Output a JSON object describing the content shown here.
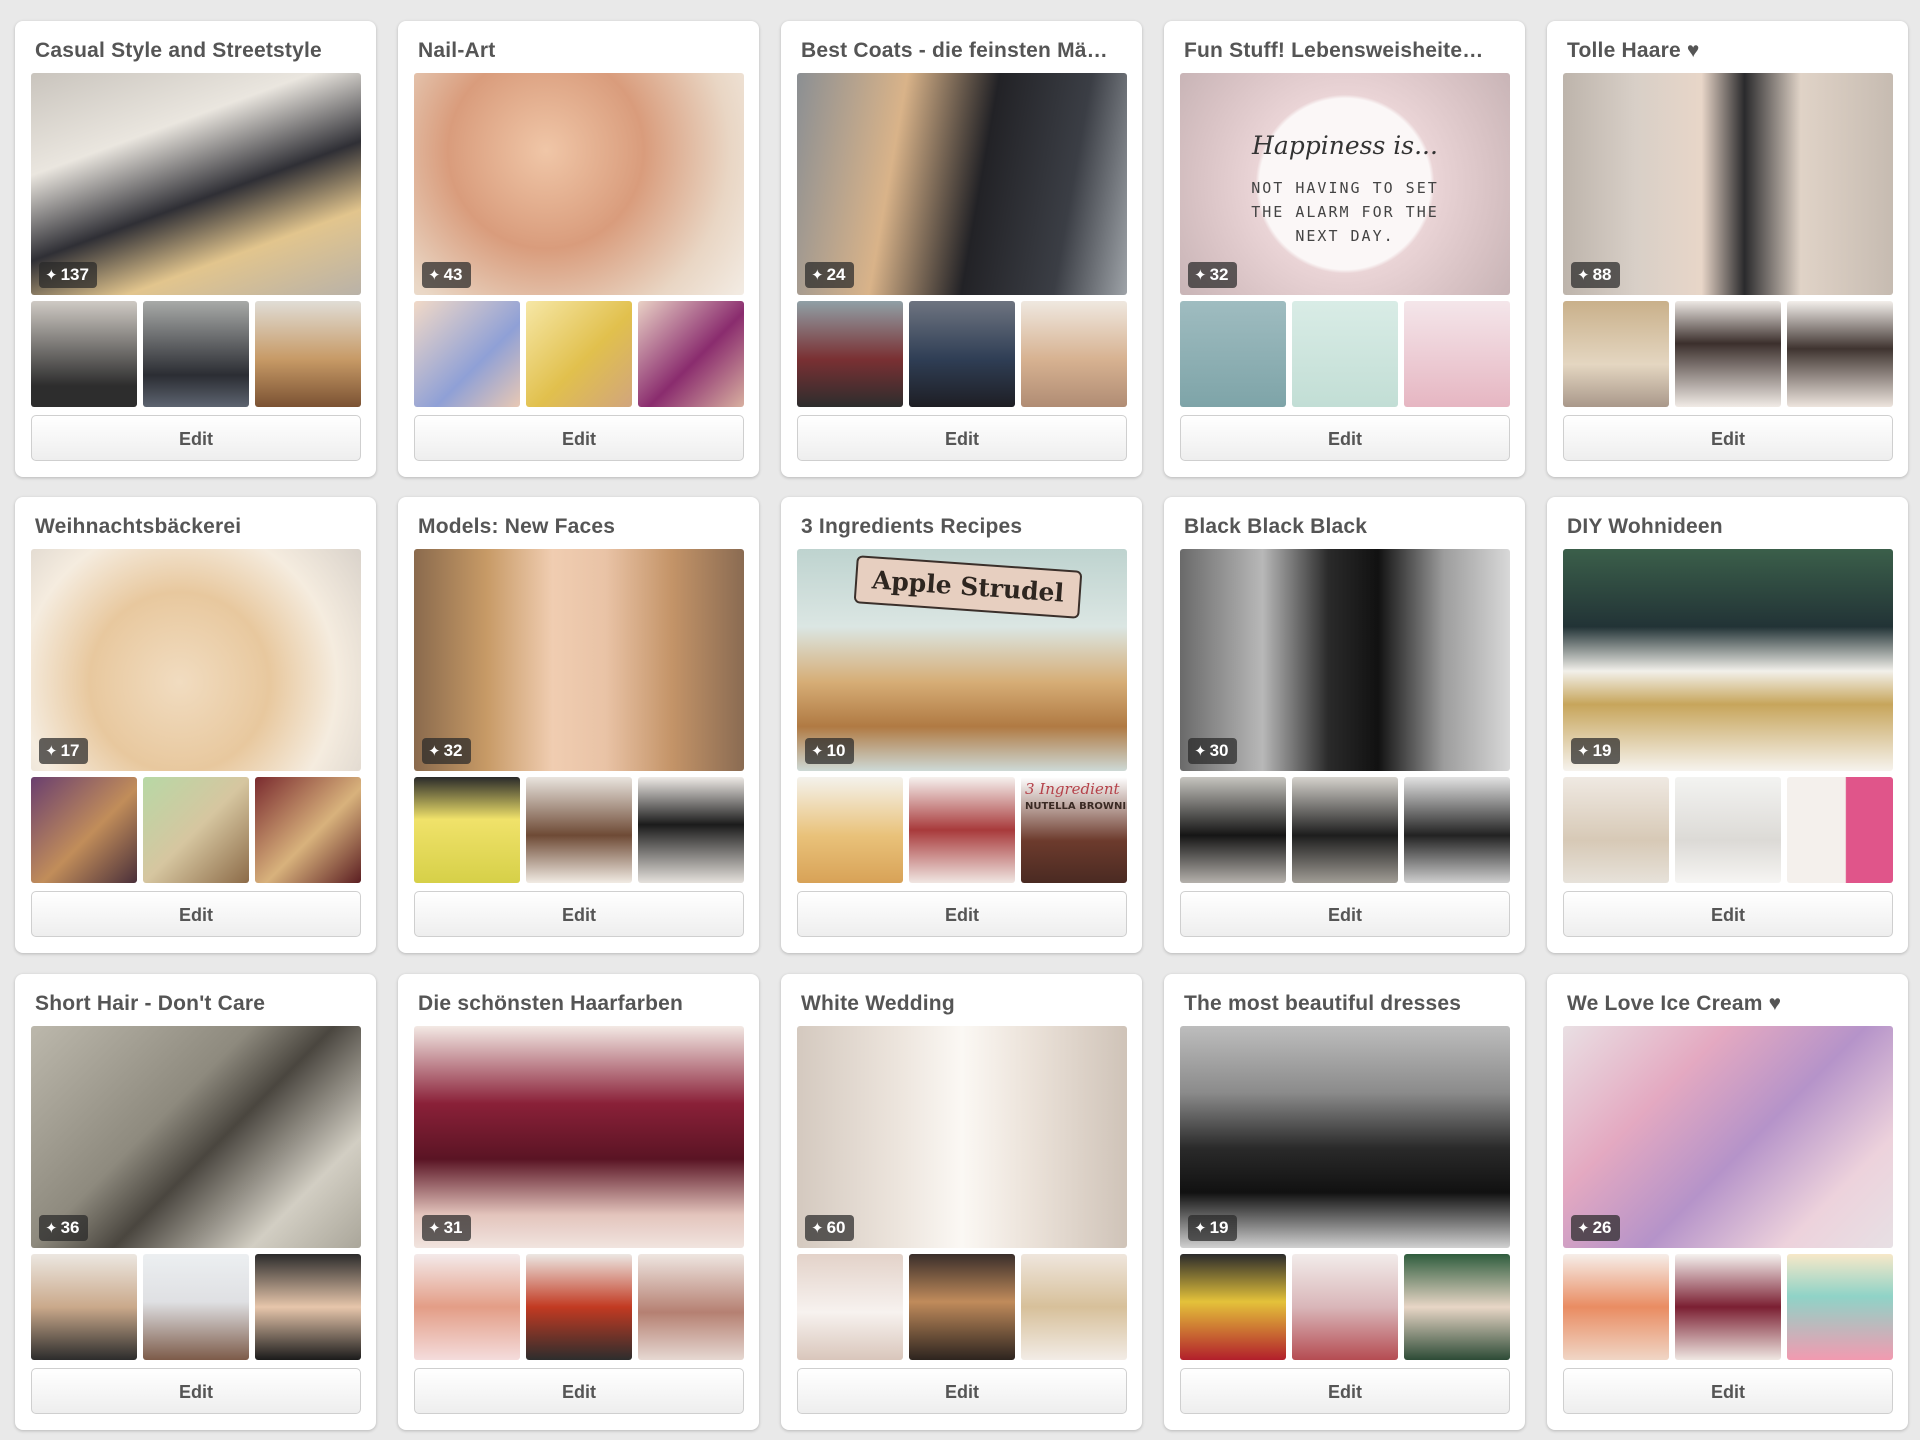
{
  "edit_label": "Edit",
  "pin_glyph": "📌",
  "boards": [
    {
      "title": "Casual Style and Streetstyle",
      "pins": "137"
    },
    {
      "title": "Nail-Art",
      "pins": "43"
    },
    {
      "title": "Best Coats - die feinsten Mä…",
      "pins": "24"
    },
    {
      "title": "Fun Stuff! Lebensweisheite…",
      "pins": "32"
    },
    {
      "title": "Tolle Haare ♥",
      "pins": "88"
    },
    {
      "title": "Weihnachtsbäckerei",
      "pins": "17"
    },
    {
      "title": "Models: New Faces",
      "pins": "32"
    },
    {
      "title": "3 Ingredients Recipes",
      "pins": "10"
    },
    {
      "title": "Black Black Black",
      "pins": "30"
    },
    {
      "title": "DIY Wohnideen",
      "pins": "19"
    },
    {
      "title": "Short Hair - Don't Care",
      "pins": "36"
    },
    {
      "title": "Die schönsten Haarfarben",
      "pins": "31"
    },
    {
      "title": "White Wedding",
      "pins": "60"
    },
    {
      "title": "The most beautiful dresses",
      "pins": "19"
    },
    {
      "title": "We Love Ice Cream ♥",
      "pins": "26"
    }
  ],
  "cover_texts": {
    "fun_stuff": {
      "script": "Happiness is...",
      "lines": [
        "NOT HAVING TO SET",
        "THE ALARM FOR THE",
        "NEXT DAY."
      ]
    },
    "recipes_banner": "Apple Strudel",
    "brownies_heading": "3 Ingredient",
    "brownies_sub": "NUTELLA BROWNIES"
  }
}
